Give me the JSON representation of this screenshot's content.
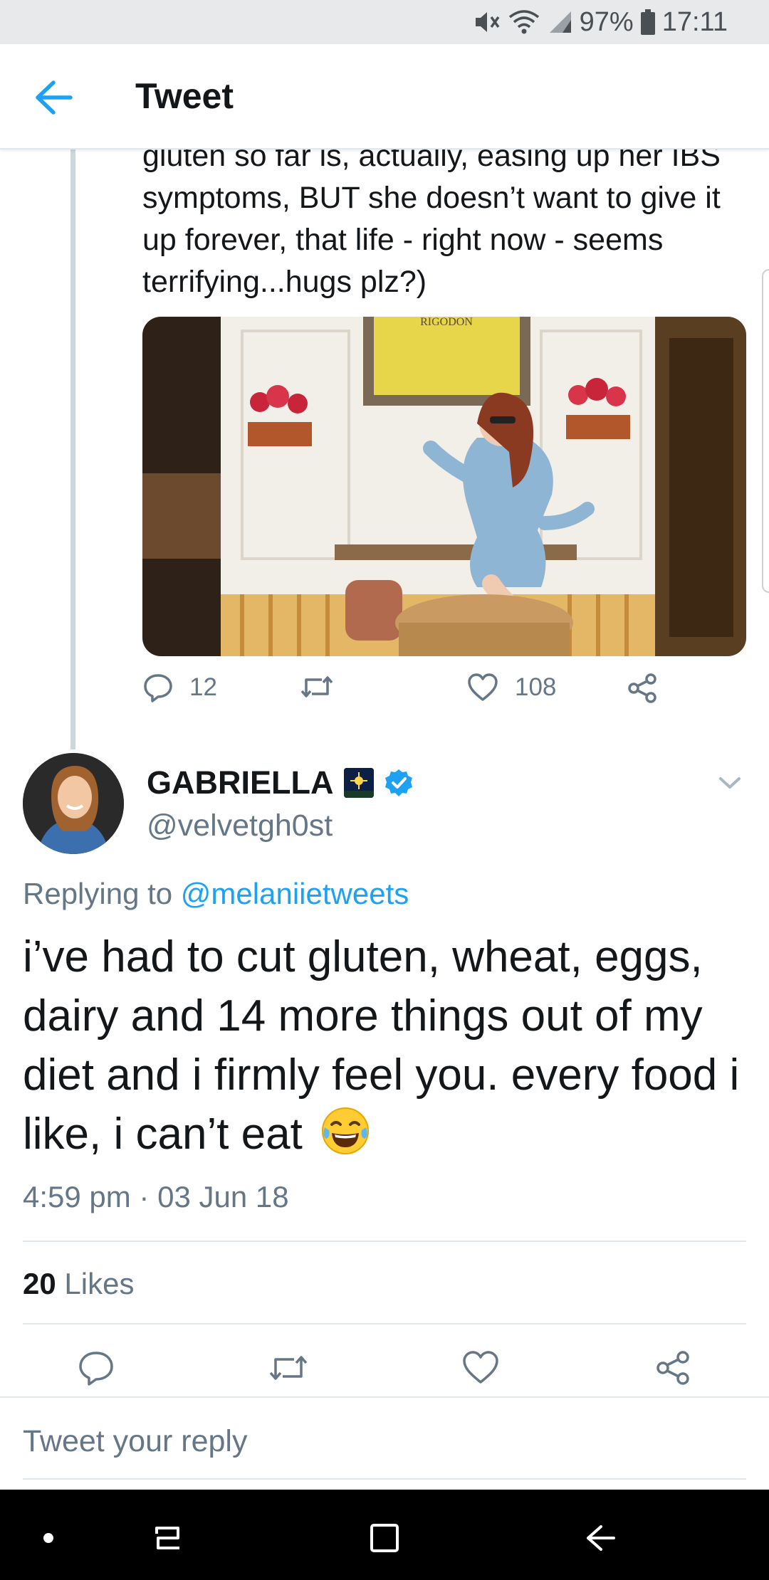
{
  "status_bar": {
    "battery": "97%",
    "time": "17:11",
    "icons": [
      "mute-icon",
      "wifi-icon",
      "signal-icon",
      "battery-icon"
    ]
  },
  "header": {
    "title": "Tweet",
    "back_icon": "arrow-left-icon"
  },
  "parent_tweet": {
    "text": "gluten so far is, actually, easing up her IBS symptoms, BUT she doesn’t want to give it up forever, that life - right now - seems terrifying...hugs plz?)",
    "media_alt": "Photo",
    "media_sign": "RIGODON",
    "replies": "12",
    "retweets": "",
    "likes": "108"
  },
  "reply_tweet": {
    "author_name": "GABRIELLA",
    "author_handle": "@velvetgh0st",
    "verified": true,
    "replying_prefix": "Replying to",
    "replying_to": "@melaniietweets",
    "body": "i’ve had to cut gluten, wheat, eggs, dairy and 14 more things out of my diet and i firmly feel you. every food i like, i can’t eat",
    "emoji": "face-with-tears-of-joy",
    "timestamp": "4:59 pm · 03 Jun 18",
    "likes_count": "20",
    "likes_label": "Likes"
  },
  "reply_box": {
    "placeholder": "Tweet your reply"
  },
  "colors": {
    "accent": "#1da1f2",
    "secondary_text": "#657786",
    "divider": "#e1e8ed"
  }
}
